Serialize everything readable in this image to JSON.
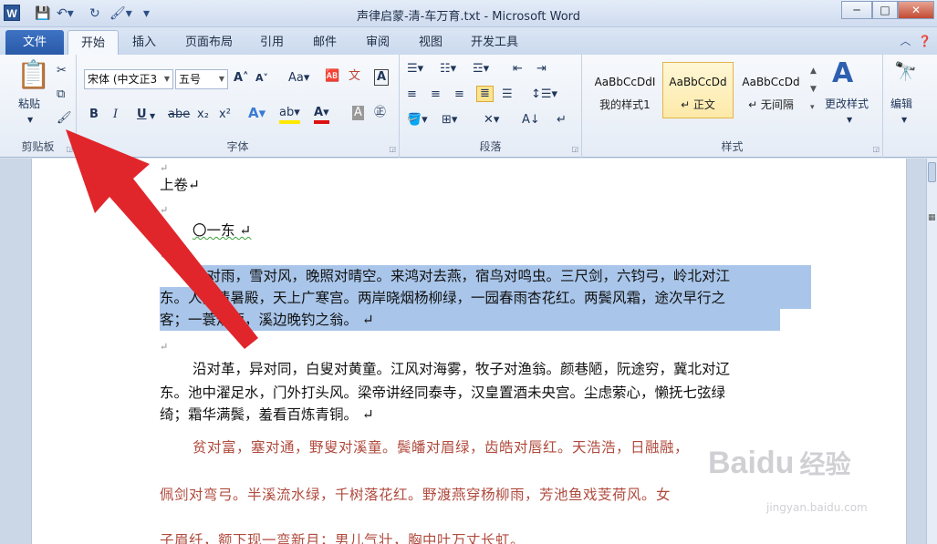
{
  "window": {
    "title": "声律启蒙-清-车万育.txt - Microsoft Word",
    "app_icon": "W",
    "controls": {
      "minimize": "─",
      "maximize": "□",
      "close": "✕"
    }
  },
  "tabs": {
    "file": "文件",
    "items": [
      "开始",
      "插入",
      "页面布局",
      "引用",
      "邮件",
      "审阅",
      "视图",
      "开发工具"
    ]
  },
  "ribbon": {
    "clipboard": {
      "paste": "粘贴",
      "label": "剪贴板"
    },
    "font": {
      "font_name": "宋体 (中文正3",
      "font_size": "五号",
      "change_case": "Aa",
      "label": "字体",
      "bold": "B",
      "italic": "I",
      "underline": "U",
      "strike": "abe",
      "subscript": "x₂",
      "superscript": "x²",
      "text_color": "A"
    },
    "paragraph": {
      "label": "段落"
    },
    "styles": {
      "label": "样式",
      "items": [
        {
          "sample": "AaBbCcDdI",
          "name": "我的样式1"
        },
        {
          "sample": "AaBbCcDd",
          "name": "↵ 正文"
        },
        {
          "sample": "AaBbCcDd",
          "name": "↵ 无间隔"
        }
      ],
      "change_styles": "更改样式",
      "editing": "编辑"
    }
  },
  "document": {
    "line_volume": "上卷↵",
    "line_heading": "〇一东 ↵",
    "para1": [
      "云对雨，雪对风，晚照对晴空。来鸿对去燕，宿鸟对鸣虫。三尺剑，六钧弓，岭北对江",
      "东。人间清暑殿，天上广寒宫。两岸晓烟杨柳绿，一园春雨杏花红。两鬓风霜，途次早行之",
      "客；一蓑烟雨，溪边晚钓之翁。 ↵"
    ],
    "para2": [
      "沿对革，异对同，白叟对黄童。江风对海雾，牧子对渔翁。颜巷陋，阮途穷，冀北对辽",
      "东。池中濯足水，门外打头风。梁帝讲经同泰寺，汉皇置酒未央宫。尘虑萦心，懒抚七弦绿",
      "绮；霜华满鬓，羞看百炼青铜。 ↵"
    ],
    "para3": [
      "贫对富，塞对通，野叟对溪童。鬓皤对眉绿，齿皓对唇红。天浩浩，日融融，",
      "佩剑对弯弓。半溪流水绿，千树落花红。野渡燕穿杨柳雨，芳池鱼戏芰荷风。女",
      "子眉纤，额下现一弯新月；男儿气壮，胸中吐万丈长虹。"
    ],
    "para_mark": "↵"
  },
  "watermark": {
    "brand": "Baidu",
    "cn": "经验",
    "url": "jingyan.baidu.com"
  },
  "colors": {
    "selection": "#a9c6ea",
    "arrow": "#e0262b",
    "accent": "#2a5aa8"
  }
}
